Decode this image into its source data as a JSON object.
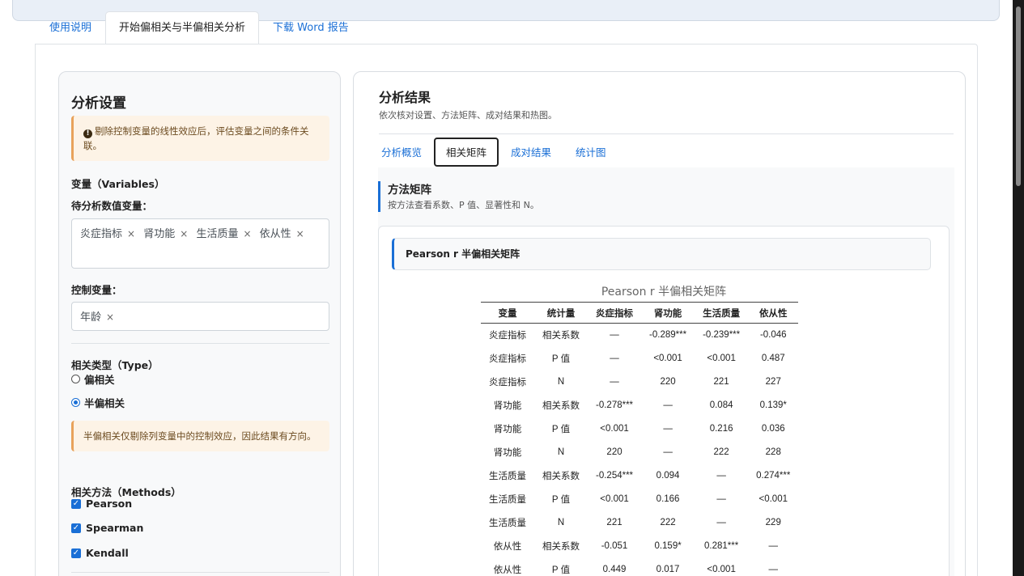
{
  "main_tabs": [
    "使用说明",
    "开始偏相关与半偏相关分析",
    "下载 Word 报告"
  ],
  "settings": {
    "title": "分析设置",
    "notice": "剔除控制变量的线性效应后，评估变量之间的条件关联。",
    "variables_heading": "变量（Variables）",
    "numeric_label": "待分析数值变量：",
    "numeric_vars": [
      "炎症指标",
      "肾功能",
      "生活质量",
      "依从性"
    ],
    "control_label": "控制变量：",
    "control_vars": [
      "年龄"
    ],
    "type_heading": "相关类型（Type）",
    "type_options": [
      "偏相关",
      "半偏相关"
    ],
    "type_selected": "半偏相关",
    "semi_notice": "半偏相关仅剔除列变量中的控制效应，因此结果有方向。",
    "methods_heading": "相关方法（Methods）",
    "methods": [
      "Pearson",
      "Spearman",
      "Kendall"
    ]
  },
  "results": {
    "title": "分析结果",
    "subtitle": "依次核对设置、方法矩阵、成对结果和热图。",
    "subtabs": [
      "分析概览",
      "相关矩阵",
      "成对结果",
      "统计图"
    ],
    "active_subtab": "相关矩阵",
    "section_title": "方法矩阵",
    "section_sub": "按方法查看系数、P 值、显著性和 N。",
    "matrix_box_title": "Pearson r 半偏相关矩阵",
    "matrix_caption": "Pearson r 半偏相关矩阵",
    "columns": [
      "变量",
      "统计量",
      "炎症指标",
      "肾功能",
      "生活质量",
      "依从性"
    ],
    "rows": [
      [
        "炎症指标",
        "相关系数",
        "—",
        "-0.289***",
        "-0.239***",
        "-0.046"
      ],
      [
        "炎症指标",
        "P 值",
        "—",
        "<0.001",
        "<0.001",
        "0.487"
      ],
      [
        "炎症指标",
        "N",
        "—",
        "220",
        "221",
        "227"
      ],
      [
        "肾功能",
        "相关系数",
        "-0.278***",
        "—",
        "0.084",
        "0.139*"
      ],
      [
        "肾功能",
        "P 值",
        "<0.001",
        "—",
        "0.216",
        "0.036"
      ],
      [
        "肾功能",
        "N",
        "220",
        "—",
        "222",
        "228"
      ],
      [
        "生活质量",
        "相关系数",
        "-0.254***",
        "0.094",
        "—",
        "0.274***"
      ],
      [
        "生活质量",
        "P 值",
        "<0.001",
        "0.166",
        "—",
        "<0.001"
      ],
      [
        "生活质量",
        "N",
        "221",
        "222",
        "—",
        "229"
      ],
      [
        "依从性",
        "相关系数",
        "-0.051",
        "0.159*",
        "0.281***",
        "—"
      ],
      [
        "依从性",
        "P 值",
        "0.449",
        "0.017",
        "<0.001",
        "—"
      ]
    ]
  },
  "colors": {
    "accent": "#1a6fd6",
    "warning_bg": "#fdf3e6",
    "warning_border": "#e8a25b"
  }
}
